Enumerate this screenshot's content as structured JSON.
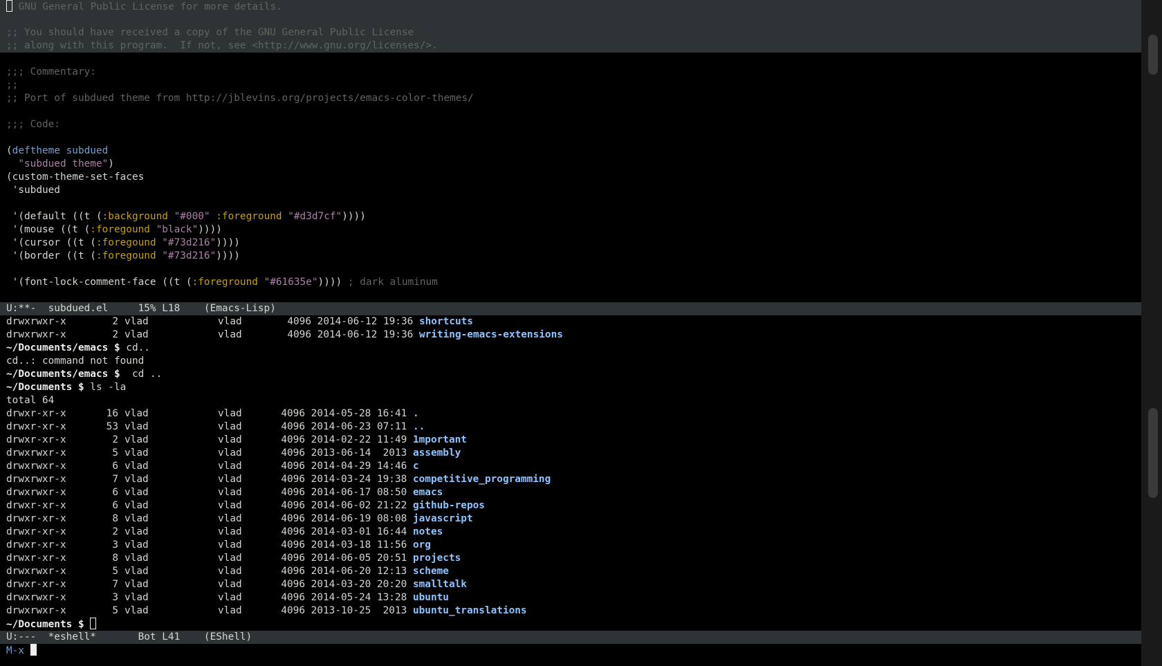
{
  "editor": {
    "comment_header_lines": [
      "; GNU General Public License for more details.",
      "",
      ";; You should have received a copy of the GNU General Public License",
      ";; along with this program.  If not, see <http://www.gnu.org/licenses/>."
    ],
    "commentary_lines": [
      "",
      ";;; Commentary:",
      ";;",
      ";; Port of subdued theme from http://jblevins.org/projects/emacs-color-themes/",
      "",
      ";;; Code:",
      ""
    ],
    "deftheme": {
      "open": "(",
      "kw": "deftheme",
      "name": " subdued",
      "doc_indent": "  ",
      "doc": "\"subdued theme\"",
      "close": ")"
    },
    "set_faces": [
      "(custom-theme-set-faces",
      " 'subdued",
      ""
    ],
    "faces": [
      {
        "pre": " '(default ((t (",
        "k1": ":background",
        "s1": " \"#000\"",
        "k2": " :foreground",
        "s2": " \"#d3d7cf\"",
        "post": "))))",
        "comment": ""
      },
      {
        "pre": " '(mouse ((t (",
        "k1": ":foregound",
        "s1": " \"black\"",
        "k2": "",
        "s2": "",
        "post": "))))",
        "comment": ""
      },
      {
        "pre": " '(cursor ((t (",
        "k1": ":foregound",
        "s1": " \"#73d216\"",
        "k2": "",
        "s2": "",
        "post": "))))",
        "comment": ""
      },
      {
        "pre": " '(border ((t (",
        "k1": ":foregound",
        "s1": " \"#73d216\"",
        "k2": "",
        "s2": "",
        "post": "))))",
        "comment": ""
      }
    ],
    "last_face": {
      "pre": " '(font-lock-comment-face ((t (",
      "k1": ":foreground",
      "s1": " \"#61635e\"",
      "post": ")))) ",
      "comment": "; dark aluminum"
    }
  },
  "modeline_top": "U:**-  subdued.el     15% L18    (Emacs-Lisp)",
  "shell": {
    "prev_listing": [
      {
        "perm": "drwxrwxr-x",
        "links": "2",
        "user": "vlad",
        "group": "vlad",
        "size": "4096",
        "date": "2014-06-12",
        "time": "19:36",
        "name": "shortcuts"
      },
      {
        "perm": "drwxrwxr-x",
        "links": "2",
        "user": "vlad",
        "group": "vlad",
        "size": "4096",
        "date": "2014-06-12",
        "time": "19:36",
        "name": "writing-emacs-extensions"
      }
    ],
    "session": [
      {
        "prompt": "~/Documents/emacs $",
        "cmd": " cd.."
      },
      {
        "output": "cd..: command not found"
      },
      {
        "prompt": "~/Documents/emacs $",
        "cmd": "  cd .."
      },
      {
        "prompt": "~/Documents $",
        "cmd": " ls -la"
      },
      {
        "output": "total 64"
      }
    ],
    "listing": [
      {
        "perm": "drwxr-xr-x",
        "links": "16",
        "user": "vlad",
        "group": "vlad",
        "size": "4096",
        "date": "2014-05-28",
        "time": "16:41",
        "name": "."
      },
      {
        "perm": "drwxr-xr-x",
        "links": "53",
        "user": "vlad",
        "group": "vlad",
        "size": "4096",
        "date": "2014-06-23",
        "time": "07:11",
        "name": ".."
      },
      {
        "perm": "drwxr-xr-x",
        "links": "2",
        "user": "vlad",
        "group": "vlad",
        "size": "4096",
        "date": "2014-02-22",
        "time": "11:49",
        "name": "1mportant"
      },
      {
        "perm": "drwxrwxr-x",
        "links": "5",
        "user": "vlad",
        "group": "vlad",
        "size": "4096",
        "date": "2013-06-14",
        "time": " 2013",
        "name": "assembly"
      },
      {
        "perm": "drwxrwxr-x",
        "links": "6",
        "user": "vlad",
        "group": "vlad",
        "size": "4096",
        "date": "2014-04-29",
        "time": "14:46",
        "name": "c"
      },
      {
        "perm": "drwxrwxr-x",
        "links": "7",
        "user": "vlad",
        "group": "vlad",
        "size": "4096",
        "date": "2014-03-24",
        "time": "19:38",
        "name": "competitive_programming"
      },
      {
        "perm": "drwxrwxr-x",
        "links": "6",
        "user": "vlad",
        "group": "vlad",
        "size": "4096",
        "date": "2014-06-17",
        "time": "08:50",
        "name": "emacs"
      },
      {
        "perm": "drwxr-xr-x",
        "links": "6",
        "user": "vlad",
        "group": "vlad",
        "size": "4096",
        "date": "2014-06-02",
        "time": "21:22",
        "name": "github-repos"
      },
      {
        "perm": "drwxr-xr-x",
        "links": "8",
        "user": "vlad",
        "group": "vlad",
        "size": "4096",
        "date": "2014-06-19",
        "time": "08:08",
        "name": "javascript"
      },
      {
        "perm": "drwxr-xr-x",
        "links": "2",
        "user": "vlad",
        "group": "vlad",
        "size": "4096",
        "date": "2014-03-01",
        "time": "16:44",
        "name": "notes"
      },
      {
        "perm": "drwxr-xr-x",
        "links": "3",
        "user": "vlad",
        "group": "vlad",
        "size": "4096",
        "date": "2014-03-18",
        "time": "11:56",
        "name": "org"
      },
      {
        "perm": "drwxr-xr-x",
        "links": "8",
        "user": "vlad",
        "group": "vlad",
        "size": "4096",
        "date": "2014-06-05",
        "time": "20:51",
        "name": "projects"
      },
      {
        "perm": "drwxrwxr-x",
        "links": "5",
        "user": "vlad",
        "group": "vlad",
        "size": "4096",
        "date": "2014-06-20",
        "time": "12:13",
        "name": "scheme"
      },
      {
        "perm": "drwxr-xr-x",
        "links": "7",
        "user": "vlad",
        "group": "vlad",
        "size": "4096",
        "date": "2014-03-20",
        "time": "20:20",
        "name": "smalltalk"
      },
      {
        "perm": "drwxrwxr-x",
        "links": "3",
        "user": "vlad",
        "group": "vlad",
        "size": "4096",
        "date": "2014-05-24",
        "time": "13:28",
        "name": "ubuntu"
      },
      {
        "perm": "drwxrwxr-x",
        "links": "5",
        "user": "vlad",
        "group": "vlad",
        "size": "4096",
        "date": "2013-10-25",
        "time": " 2013",
        "name": "ubuntu_translations"
      }
    ],
    "final_prompt": "~/Documents $"
  },
  "modeline_bottom": "U:---  *eshell*       Bot L41    (EShell)",
  "minibuffer": {
    "label": "M-x"
  }
}
